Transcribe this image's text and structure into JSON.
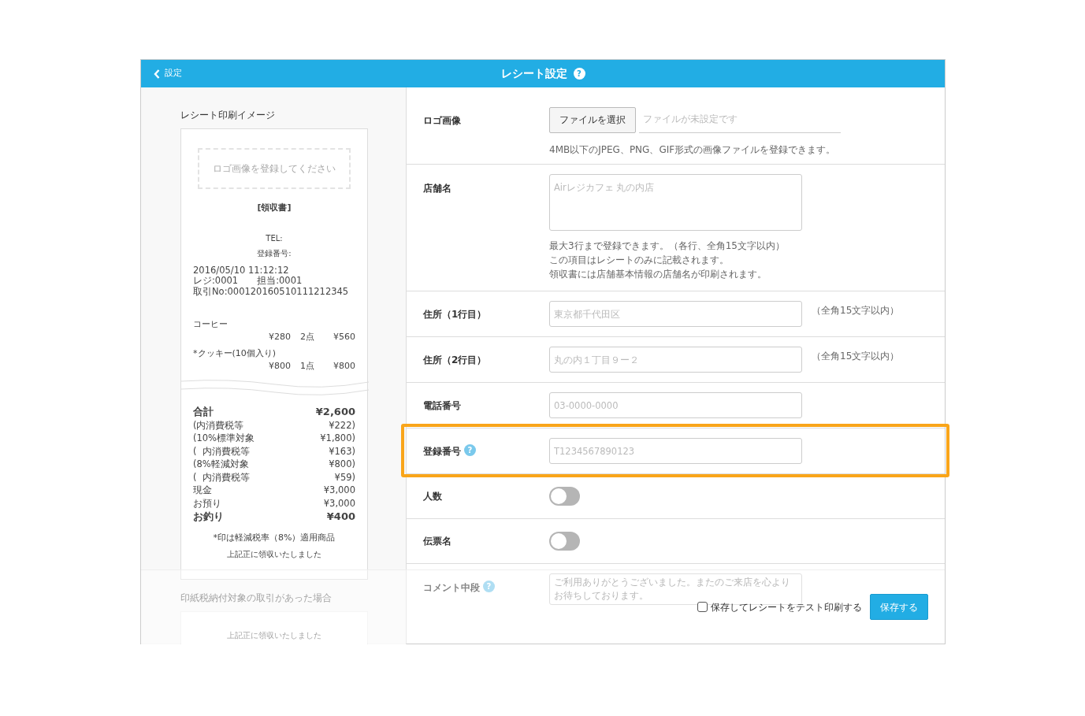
{
  "header": {
    "back_label": "設定",
    "title": "レシート設定",
    "help": "?"
  },
  "preview": {
    "title": "レシート印刷イメージ",
    "logo_placeholder": "ロゴ画像を登録してください",
    "doc_title": "[領収書]",
    "tel": "TEL:",
    "reg_no": "登録番号:",
    "meta_lines": [
      "2016/05/10 11:12:12",
      "レジ:0001　　担当:0001",
      "取引No:000120160510111212345"
    ],
    "items": [
      {
        "name": "コーヒー",
        "price": "¥280",
        "qty": "2点",
        "amount": "¥560"
      },
      {
        "name": "*クッキー(10個入り)",
        "price": "¥800",
        "qty": "1点",
        "amount": "¥800"
      }
    ],
    "totals": [
      {
        "label": "合計",
        "value": "¥2,600",
        "bold": true
      },
      {
        "label": "(内消費税等",
        "value": "¥222)",
        "bold": false
      },
      {
        "label": "(10%標準対象",
        "value": "¥1,800)",
        "bold": false
      },
      {
        "label": "(  内消費税等",
        "value": "¥163)",
        "bold": false
      },
      {
        "label": "(8%軽減対象",
        "value": "¥800)",
        "bold": false
      },
      {
        "label": "(  内消費税等",
        "value": "¥59)",
        "bold": false
      },
      {
        "label": "現金",
        "value": "¥3,000",
        "bold": false
      },
      {
        "label": "お預り",
        "value": "¥3,000",
        "bold": false
      },
      {
        "label": "お釣り",
        "value": "¥400",
        "bold": true
      }
    ],
    "note": "*印は軽減税率（8%）適用商品",
    "received": "上記正に領収いたしました"
  },
  "stamp_preview": {
    "title": "印紙税納付対象の取引があった場合",
    "received": "上記正に領収いたしました"
  },
  "settings": [
    {
      "kind": "file",
      "label": "ロゴ画像",
      "button": "ファイルを選択",
      "file_status": "ファイルが未設定です",
      "hints": [
        "4MB以下のJPEG、PNG、GIF形式の画像ファイルを登録できます。"
      ],
      "highlighted": false
    },
    {
      "kind": "textarea",
      "label": "店舗名",
      "placeholder": "Airレジカフェ 丸の内店",
      "hints": [
        "最大3行まで登録できます。（各行、全角15文字以内）",
        "この項目はレシートのみに記載されます。",
        "領収書には店舗基本情報の店舗名が印刷されます。"
      ],
      "highlighted": false
    },
    {
      "kind": "text",
      "label": "住所（1行目）",
      "placeholder": "東京都千代田区",
      "note": "（全角15文字以内）",
      "highlighted": false
    },
    {
      "kind": "text",
      "label": "住所（2行目）",
      "placeholder": "丸の内１丁目９ー２",
      "note": "（全角15文字以内）",
      "highlighted": false
    },
    {
      "kind": "text",
      "label": "電話番号",
      "placeholder": "03-0000-0000",
      "highlighted": false
    },
    {
      "kind": "text",
      "label": "登録番号",
      "help": "?",
      "placeholder": "T1234567890123",
      "highlighted": true
    },
    {
      "kind": "toggle",
      "label": "人数",
      "on": false,
      "highlighted": false
    },
    {
      "kind": "toggle",
      "label": "伝票名",
      "on": false,
      "highlighted": false
    },
    {
      "kind": "textarea",
      "label": "コメント中段",
      "help": "?",
      "placeholder": "ご利用ありがとうございました。またのご来店を心よりお待ちしております。",
      "highlighted": false
    }
  ],
  "footer": {
    "test_print": {
      "label": "保存してレシートをテスト印刷する",
      "checked": false
    },
    "save": "保存する"
  }
}
